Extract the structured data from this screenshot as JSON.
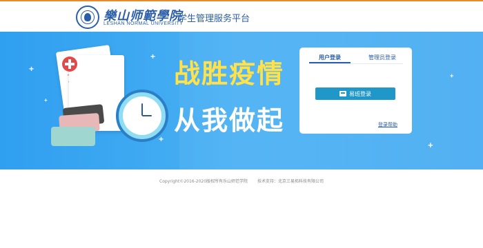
{
  "header": {
    "school_name_cn": "樂山师範學院",
    "school_name_en": "LESHAN NORMAL UNIVERSITY",
    "platform_title": "学生管理服务平台"
  },
  "banner": {
    "slogan_line1": "战胜疫情",
    "slogan_line2": "从我做起"
  },
  "login": {
    "tabs": [
      {
        "label": "用户登录",
        "active": true
      },
      {
        "label": "管理员登录",
        "active": false
      }
    ],
    "login_button_label": "易班登录",
    "help_link_label": "登录帮助"
  },
  "footer": {
    "copyright": "Copyright©2016-2020版权所有乐山师范学院",
    "tech_support": "技术支持：北京三易拓科技有限公司"
  },
  "colors": {
    "accent_orange": "#e88a2a",
    "brand_blue": "#2a5ea8",
    "banner_blue": "#3ba6f1",
    "slogan_yellow": "#ffe14a",
    "button_blue": "#1f97c8"
  }
}
